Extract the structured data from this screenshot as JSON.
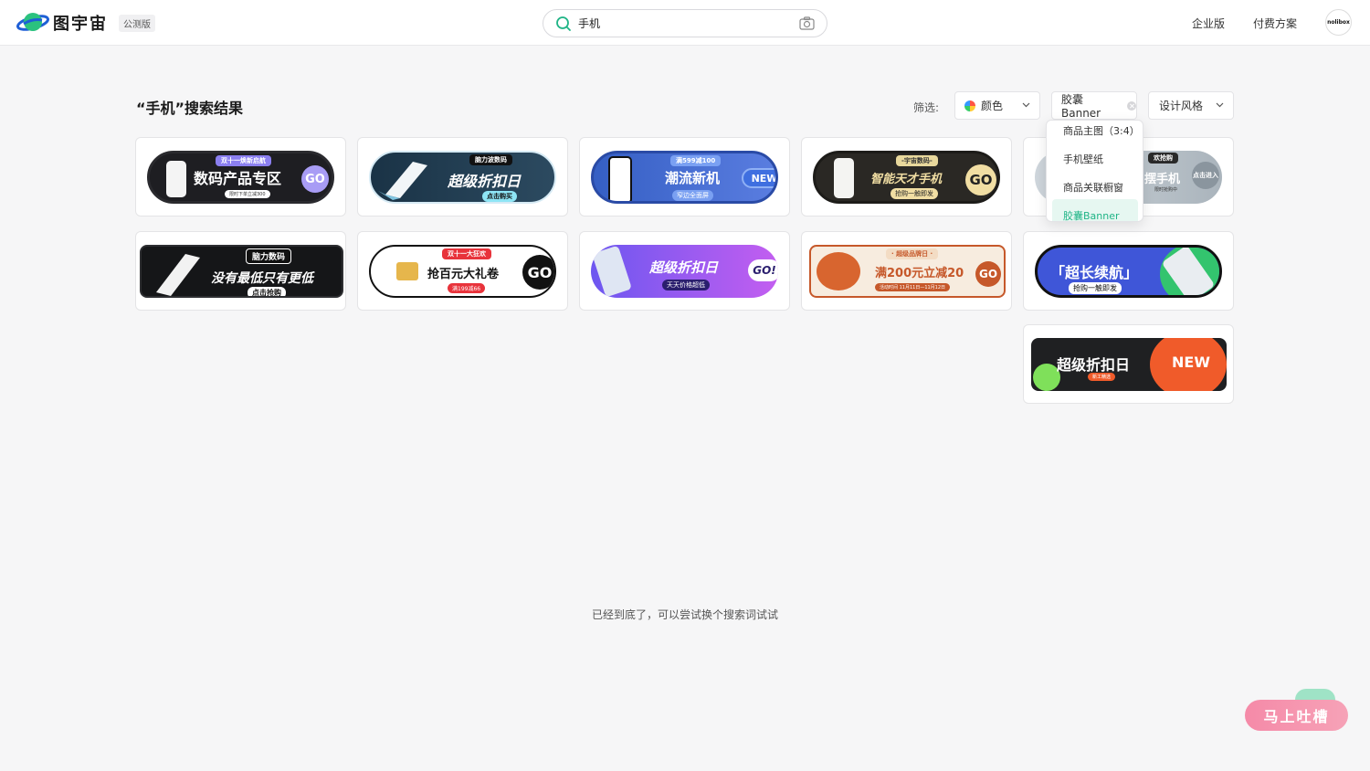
{
  "header": {
    "brand": "图宇宙",
    "badge": "公测版",
    "search_value": "手机",
    "nav": [
      "企业版",
      "付费方案"
    ],
    "avatar_text": "nolibox"
  },
  "results": {
    "title": "“手机”搜索结果",
    "filter_label": "筛选:",
    "filters": [
      {
        "label": "颜色"
      },
      {
        "label": "胶囊Banner"
      },
      {
        "label": "设计风格"
      }
    ],
    "dropdown": [
      "商品主图（3:4）",
      "手机壁纸",
      "商品关联橱窗",
      "胶囊Banner"
    ],
    "end_note": "已经到底了，可以尝试换个搜索词试试"
  },
  "cards": [
    {
      "tag": "双十一焕新启航",
      "title": "数码产品专区",
      "sub": "限时下单立减300",
      "go": "GO"
    },
    {
      "tag": "脑力波数码",
      "title": "超级折扣日",
      "sub": "点击购买"
    },
    {
      "tag": "满599减100",
      "title": "潮流新机",
      "sub": "窄边全面屏",
      "go": "NEW"
    },
    {
      "tag": "-宇宙数码-",
      "title": "智能天才手机",
      "sub": "抢购一触即发",
      "go": "GO"
    },
    {
      "tag": "欢抢购",
      "title": "摆手机",
      "sub": "限时抢购中",
      "go": "点击进入"
    },
    {
      "tag": "脑力数码",
      "title": "没有最低只有更低",
      "sub": "点击抢购"
    },
    {
      "tag": "双十一大狂欢",
      "title": "抢百元大礼卷",
      "sub": "满199减66",
      "go": "GO"
    },
    {
      "tag": "",
      "title": "超级折扣日",
      "sub": "天天价格超低",
      "go": "GO!"
    },
    {
      "tag": "· 超级品牌日 ·",
      "title": "满200元立减20",
      "sub": "活动时间  11月11日—11月12日",
      "go": "GO"
    },
    {
      "tag": "",
      "title": "「超长续航」",
      "sub": "抢购一触即发"
    },
    {
      "tag": "新品首发",
      "title": "超级折扣日",
      "sub": "新工精选",
      "go": "NEW"
    }
  ],
  "feedback": "马上吐槽",
  "colors": {
    "accent": "#1fb486",
    "dark": "#1b1b1b",
    "pink": "#f58aa8"
  }
}
